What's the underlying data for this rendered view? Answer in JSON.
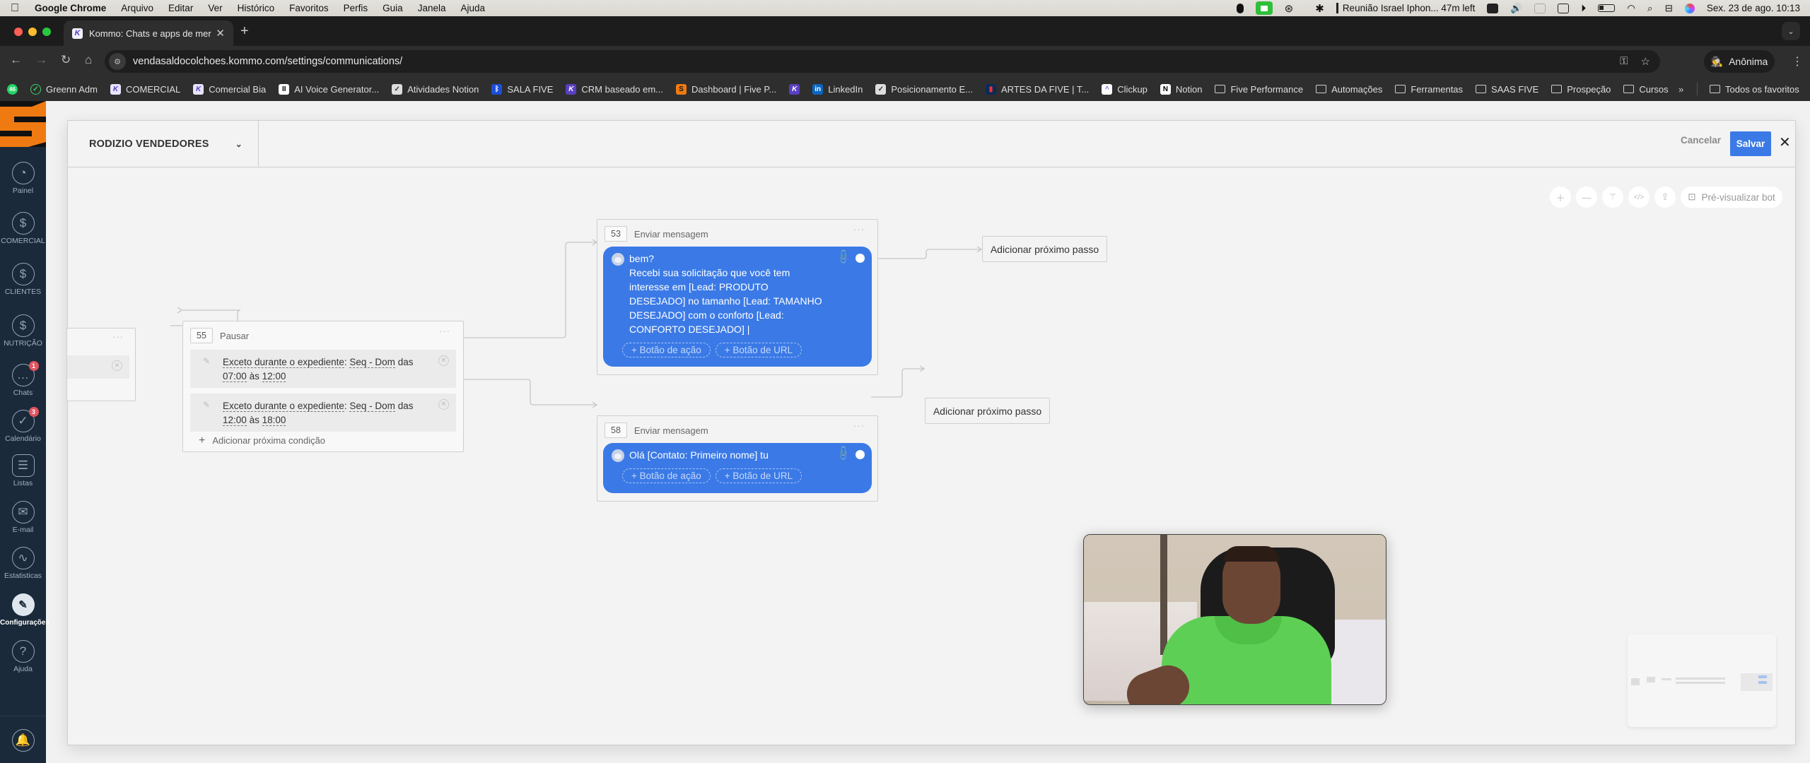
{
  "menubar": {
    "app_name": "Google Chrome",
    "menus": [
      "Arquivo",
      "Editar",
      "Ver",
      "Histórico",
      "Favoritos",
      "Perfis",
      "Guia",
      "Janela",
      "Ajuda"
    ],
    "meeting_status": "Reunião Israel Iphon... 47m left",
    "datetime": "Sex. 23 de ago.  10:13"
  },
  "browser": {
    "tab_title": "Kommo: Chats e apps de mer",
    "url": "vendasaldocolchoes.kommo.com/settings/communications/",
    "profile_label": "Anônima",
    "bookmarks": [
      {
        "label": "",
        "icon": "whatsapp-icon",
        "badge": "46"
      },
      {
        "label": "Greenn Adm",
        "icon": "greenn-icon"
      },
      {
        "label": "COMERCIAL",
        "icon": "kommo-icon"
      },
      {
        "label": "Comercial Bia",
        "icon": "kommo-icon"
      },
      {
        "label": "AI Voice Generator...",
        "icon": "elevenlabs-icon"
      },
      {
        "label": "Atividades Notion",
        "icon": "checkbox-icon"
      },
      {
        "label": "SALA FIVE",
        "icon": "bluetooth-icon"
      },
      {
        "label": "CRM baseado em...",
        "icon": "kommo-icon"
      },
      {
        "label": "Dashboard | Five P...",
        "icon": "five-icon"
      },
      {
        "label": "",
        "icon": "kommo-icon"
      },
      {
        "label": "LinkedIn",
        "icon": "linkedin-icon"
      },
      {
        "label": "Posicionamento E...",
        "icon": "checkbox-icon"
      },
      {
        "label": "ARTES DA FIVE | T...",
        "icon": "flag-icon"
      },
      {
        "label": "Clickup",
        "icon": "clickup-icon"
      },
      {
        "label": "Notion",
        "icon": "notion-icon"
      },
      {
        "label": "Five Performance",
        "icon": "folder-icon"
      },
      {
        "label": "Automações",
        "icon": "folder-icon"
      },
      {
        "label": "Ferramentas",
        "icon": "folder-icon"
      },
      {
        "label": "SAAS FIVE",
        "icon": "folder-icon"
      },
      {
        "label": "Prospeção",
        "icon": "folder-icon"
      },
      {
        "label": "Cursos",
        "icon": "folder-icon"
      }
    ],
    "bookmarks_more": "»",
    "all_bookmarks": "Todos os favoritos"
  },
  "sidebar": {
    "items": [
      {
        "label": "Painel",
        "icon": "dashboard-gauge-icon",
        "glyph": "◔"
      },
      {
        "label": "COMERCIAL",
        "icon": "dollar-bag-icon",
        "glyph": "$"
      },
      {
        "label": "CLIENTES",
        "icon": "dollar-bag-icon",
        "glyph": "$"
      },
      {
        "label": "NUTRIÇÃO",
        "icon": "dollar-bag-icon",
        "glyph": "$"
      },
      {
        "label": "Chats",
        "icon": "chat-bubble-icon",
        "glyph": "…",
        "badge": "1"
      },
      {
        "label": "Calendário",
        "icon": "checkmark-circle-icon",
        "glyph": "✓",
        "badge": "3"
      },
      {
        "label": "Listas",
        "icon": "list-icon",
        "glyph": "☰"
      },
      {
        "label": "E-mail",
        "icon": "envelope-icon",
        "glyph": "✉"
      },
      {
        "label": "Estatisticas",
        "icon": "chart-line-icon",
        "glyph": "∿"
      },
      {
        "label": "Configurações",
        "icon": "wrench-icon",
        "glyph": "🔧",
        "active": true
      },
      {
        "label": "Ajuda",
        "icon": "question-icon",
        "glyph": "?"
      }
    ]
  },
  "editor": {
    "bot_name": "RODIZIO VENDEDORES",
    "cancel_label": "Cancelar",
    "save_label": "Salvar",
    "preview_label": "Pré-visualizar bot",
    "tools": [
      "zoom-in",
      "zoom-out",
      "magic-wand",
      "code",
      "export"
    ]
  },
  "nodes": {
    "pause": {
      "id": "55",
      "type": "Pausar",
      "conditions": [
        {
          "prefix": "Exceto durante o expediente",
          "days": "Seq - Dom",
          "das": "das",
          "from": "07:00",
          "as": "às",
          "to": "12:00"
        },
        {
          "prefix": "Exceto durante o expediente",
          "days": "Seq - Dom",
          "das": "das",
          "from": "12:00",
          "as": "às",
          "to": "18:00"
        }
      ],
      "add_condition": "Adicionar próxima condição"
    },
    "msg53": {
      "id": "53",
      "type": "Enviar mensagem",
      "text": "bem?\nRecebi sua solicitação que você tem\ninteresse em [Lead: PRODUTO\nDESEJADO] no tamanho [Lead: TAMANHO\nDESEJADO] com o conforto [Lead:\nCONFORTO DESEJADO] |",
      "action_button": "+ Botão de ação",
      "url_button": "+ Botão de URL"
    },
    "msg58": {
      "id": "58",
      "type": "Enviar mensagem",
      "text": "Olá [Contato: Primeiro nome] tu",
      "action_button": "+ Botão de ação",
      "url_button": "+ Botão de URL"
    },
    "add_step_label": "Adicionar próximo passo"
  },
  "colors": {
    "accent_blue": "#3b7ae6",
    "sidebar_bg": "#1b2a3a",
    "badge_red": "#e2545f",
    "brand_orange": "#f07a12"
  }
}
